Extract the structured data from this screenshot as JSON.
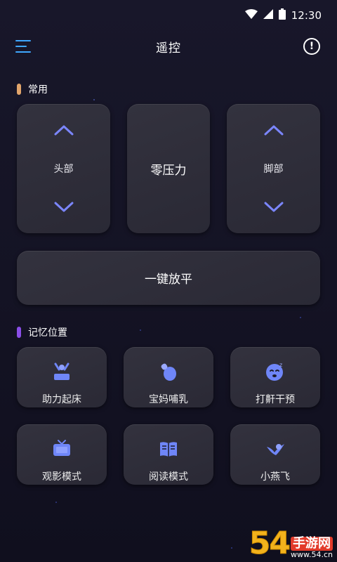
{
  "status": {
    "time": "12:30"
  },
  "header": {
    "title": "遥控"
  },
  "sections": {
    "common": "常用",
    "memory": "记忆位置"
  },
  "common": {
    "head_label": "头部",
    "zero_pressure": "零压力",
    "foot_label": "脚部",
    "flatten": "一键放平"
  },
  "memory_items": [
    {
      "label": "助力起床",
      "icon": "bed-rise-icon"
    },
    {
      "label": "宝妈哺乳",
      "icon": "baby-bottle-icon"
    },
    {
      "label": "打鼾干预",
      "icon": "snore-icon"
    },
    {
      "label": "观影模式",
      "icon": "tv-icon"
    },
    {
      "label": "阅读模式",
      "icon": "book-icon"
    },
    {
      "label": "小燕飞",
      "icon": "bird-icon"
    }
  ],
  "watermark": {
    "num": "54",
    "cn": "手游网",
    "url": "www.54.cn"
  },
  "colors": {
    "accent_blue": "#3fa7ff",
    "arrow": "#7b86ff",
    "common_dot": "#e2a56b",
    "memory_dot": "#8a4ee8",
    "icon": "#6f86f8"
  }
}
